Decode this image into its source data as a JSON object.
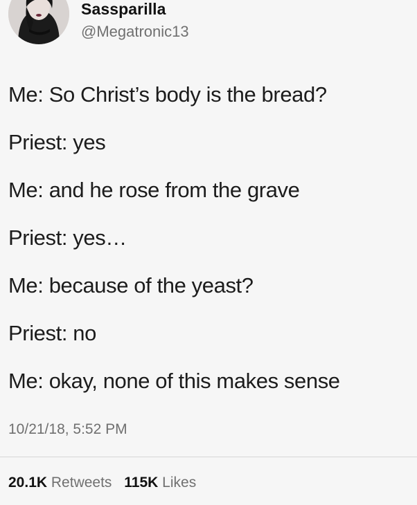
{
  "author": {
    "display_name": "Sassparilla",
    "handle": "@Megatronic13"
  },
  "tweet": {
    "lines": [
      "Me: So Christ’s body is the bread?",
      "Priest: yes",
      "Me: and he rose from the grave",
      "Priest: yes…",
      "Me: because of the yeast?",
      "Priest: no",
      "Me: okay, none of this makes sense"
    ],
    "timestamp": "10/21/18, 5:52 PM"
  },
  "stats": {
    "retweets_count": "20.1K",
    "retweets_label": "Retweets",
    "likes_count": "115K",
    "likes_label": "Likes"
  },
  "colors": {
    "background": "#f6f6f6",
    "text": "#1c1c1c",
    "secondary_text": "#707070",
    "divider": "#d6d6d6"
  }
}
